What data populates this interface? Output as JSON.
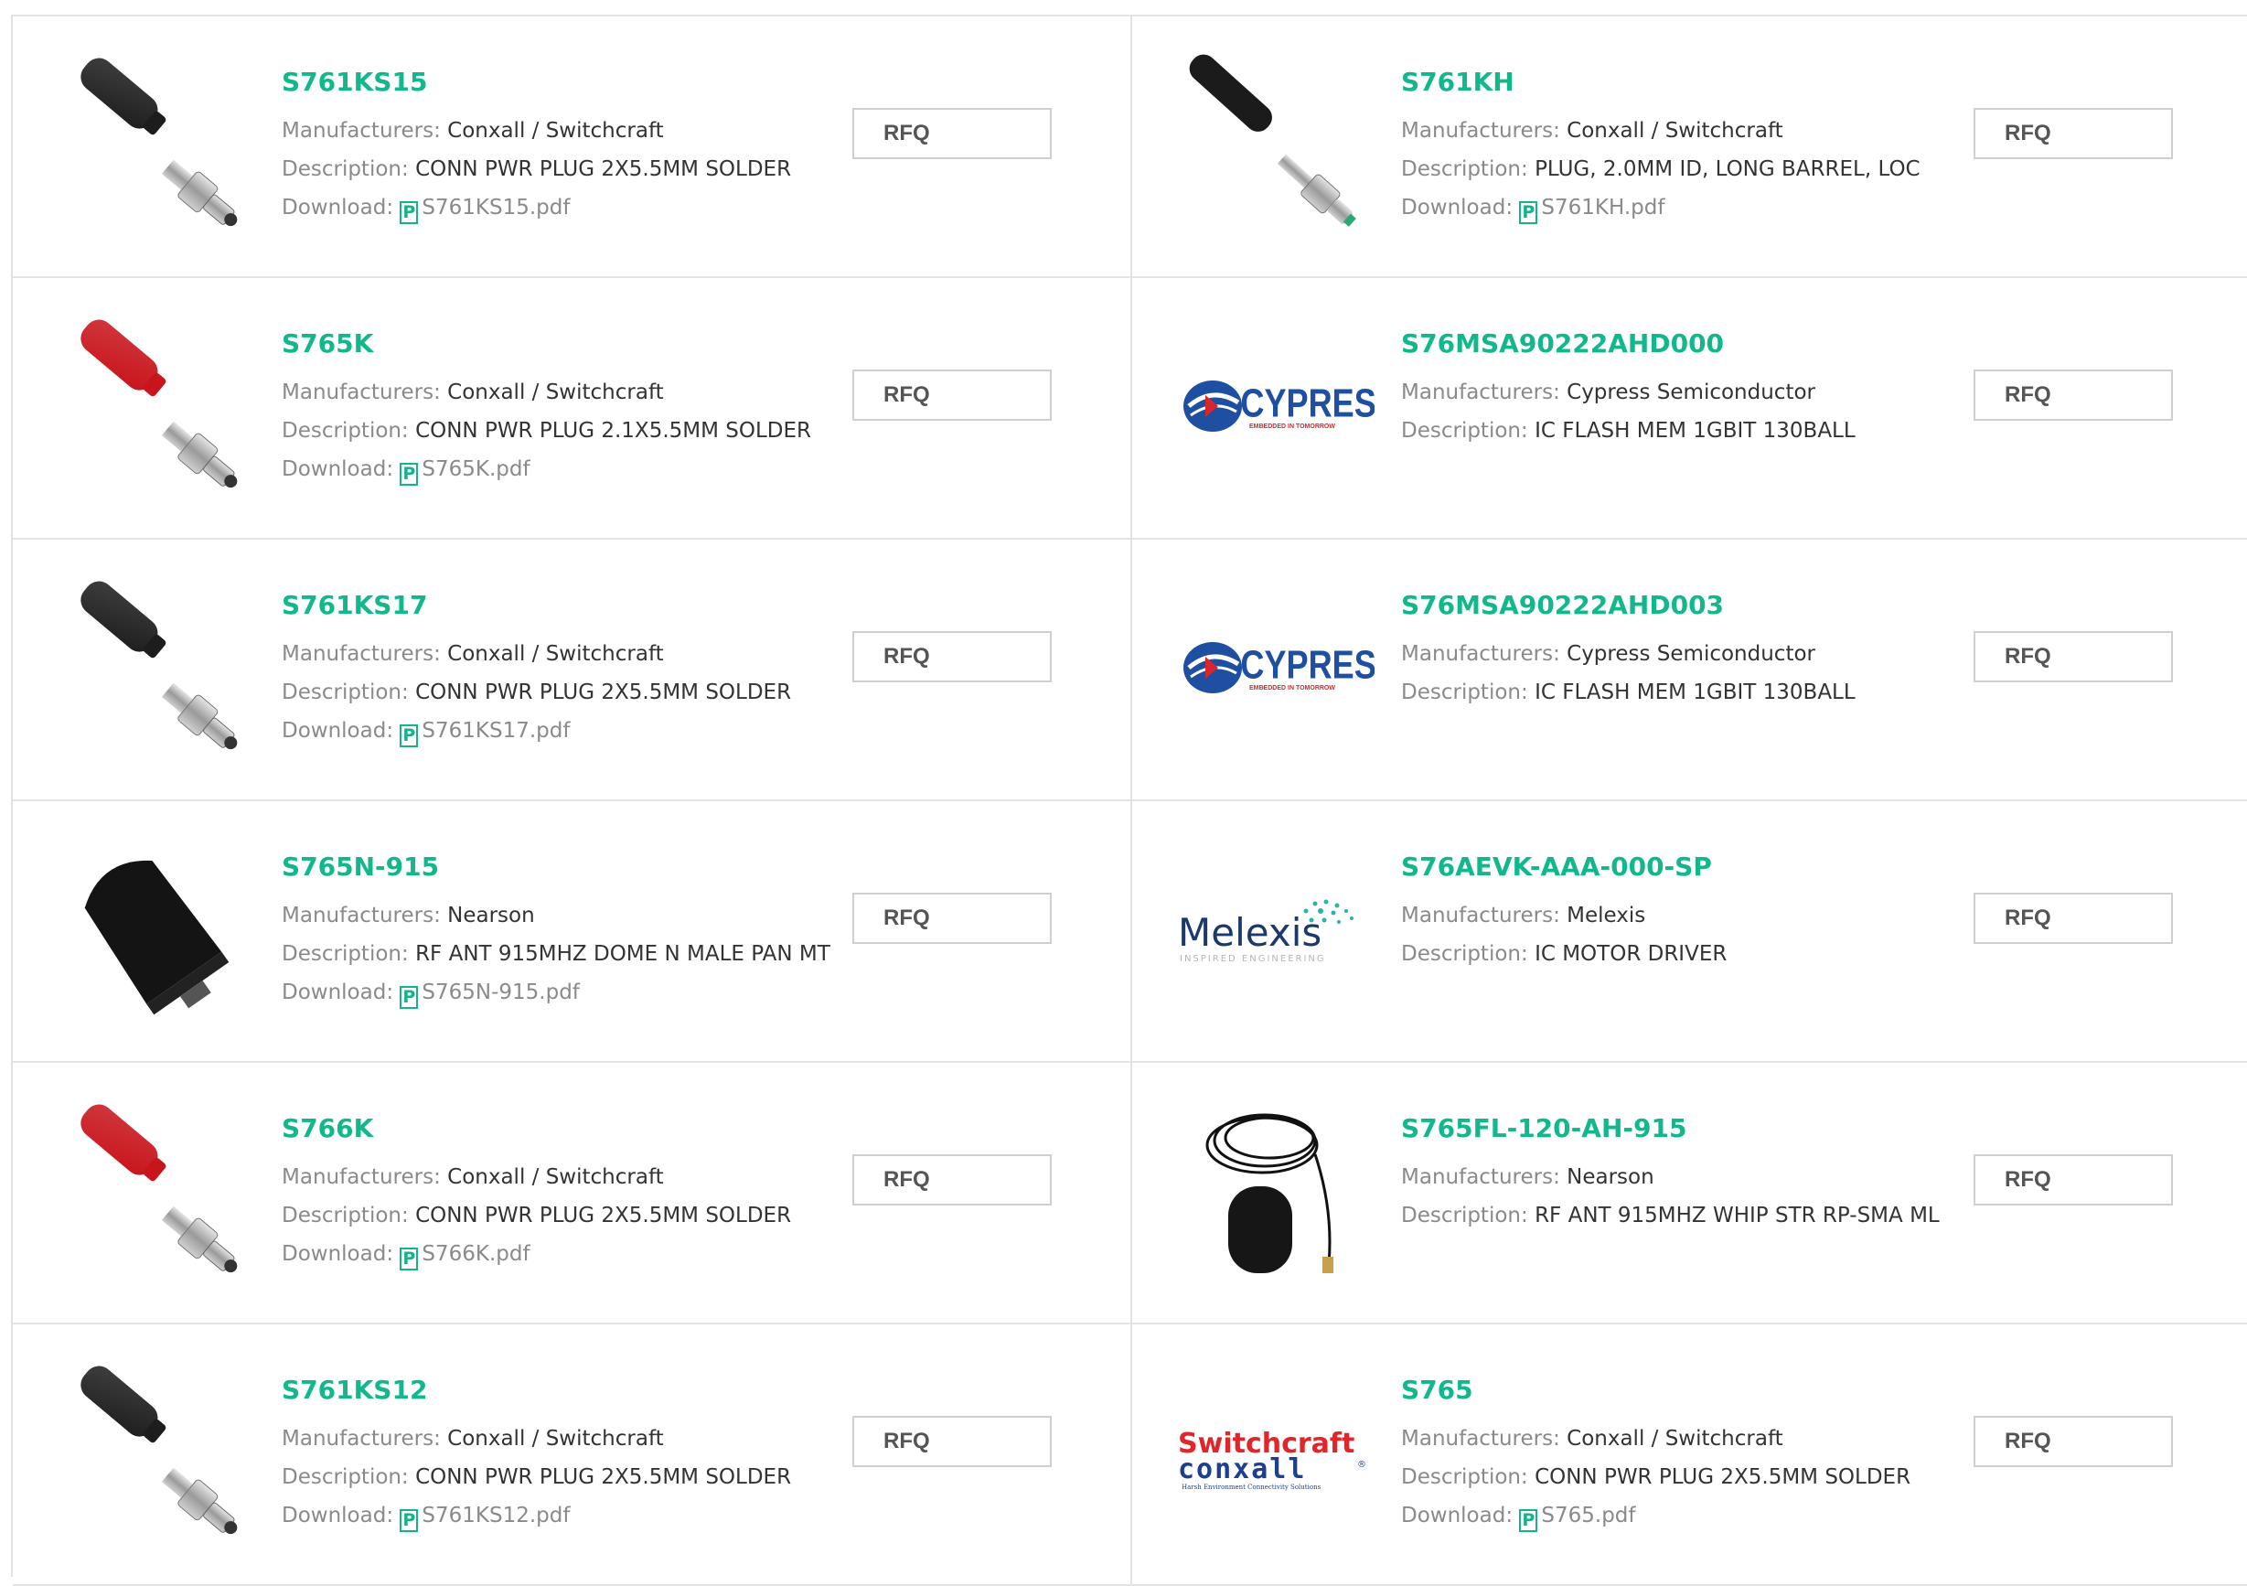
{
  "labels": {
    "manufacturers": "Manufacturers:",
    "description": "Description:",
    "download": "Download:",
    "rfq": "RFQ",
    "pdf_glyph": "P"
  },
  "products": [
    {
      "part": "S761KS15",
      "manufacturer": "Conxall / Switchcraft",
      "description": "CONN PWR PLUG 2X5.5MM SOLDER",
      "download": "S761KS15.pdf",
      "image": "plug-black-icon"
    },
    {
      "part": "S761KH",
      "manufacturer": "Conxall / Switchcraft",
      "description": "PLUG, 2.0MM ID, LONG BARREL, LOC",
      "download": "S761KH.pdf",
      "image": "plug-black-long-icon"
    },
    {
      "part": "S765K",
      "manufacturer": "Conxall / Switchcraft",
      "description": "CONN PWR PLUG 2.1X5.5MM SOLDER",
      "download": "S765K.pdf",
      "image": "plug-red-icon"
    },
    {
      "part": "S76MSA90222AHD000",
      "manufacturer": "Cypress Semiconductor",
      "description": "IC FLASH MEM 1GBIT 130BALL",
      "download": null,
      "image": "cypress-logo",
      "logo_text": "CYPRESS",
      "logo_tagline": "EMBEDDED IN TOMORROW"
    },
    {
      "part": "S761KS17",
      "manufacturer": "Conxall / Switchcraft",
      "description": "CONN PWR PLUG 2X5.5MM SOLDER",
      "download": "S761KS17.pdf",
      "image": "plug-black-icon"
    },
    {
      "part": "S76MSA90222AHD003",
      "manufacturer": "Cypress Semiconductor",
      "description": "IC FLASH MEM 1GBIT 130BALL",
      "download": null,
      "image": "cypress-logo",
      "logo_text": "CYPRESS",
      "logo_tagline": "EMBEDDED IN TOMORROW"
    },
    {
      "part": "S765N-915",
      "manufacturer": "Nearson",
      "description": "RF ANT 915MHZ DOME N MALE PAN MT",
      "download": "S765N-915.pdf",
      "image": "dome-antenna-icon"
    },
    {
      "part": "S76AEVK-AAA-000-SP",
      "manufacturer": "Melexis",
      "description": "IC MOTOR DRIVER",
      "download": null,
      "image": "melexis-logo",
      "logo_text": "Melexis",
      "logo_tagline": "INSPIRED ENGINEERING"
    },
    {
      "part": "S766K",
      "manufacturer": "Conxall / Switchcraft",
      "description": "CONN PWR PLUG 2X5.5MM SOLDER",
      "download": "S766K.pdf",
      "image": "plug-red-icon"
    },
    {
      "part": "S765FL-120-AH-915",
      "manufacturer": "Nearson",
      "description": "RF ANT 915MHZ WHIP STR RP-SMA ML",
      "download": null,
      "image": "whip-antenna-icon"
    },
    {
      "part": "S761KS12",
      "manufacturer": "Conxall / Switchcraft",
      "description": "CONN PWR PLUG 2X5.5MM SOLDER",
      "download": "S761KS12.pdf",
      "image": "plug-black-icon"
    },
    {
      "part": "S765",
      "manufacturer": "Conxall / Switchcraft",
      "description": "CONN PWR PLUG 2X5.5MM SOLDER",
      "download": "S765.pdf",
      "image": "switchcraft-conxall-logo",
      "logo_text": "Switchcraft",
      "logo_text2": "conxall",
      "logo_tagline": "Harsh Environment Connectivity Solutions"
    }
  ],
  "colors": {
    "accent": "#12b88c",
    "label": "#8a8a8a",
    "text": "#333333",
    "border": "#e3e3e3",
    "cypress_blue": "#1e4fa0",
    "cypress_red": "#d9262c",
    "switchcraft_red": "#e0262b",
    "conxall_blue": "#1e3f8f",
    "melexis_blue": "#1b3a6b",
    "melexis_teal": "#2bb3a6"
  }
}
